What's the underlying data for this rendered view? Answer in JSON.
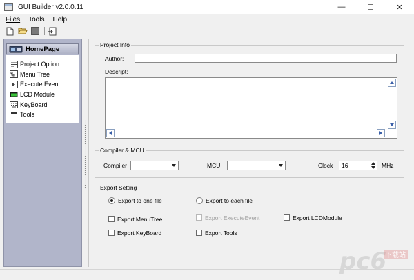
{
  "window": {
    "title": "GUI Builder v2.0.0.11",
    "controls": {
      "minimize": "—",
      "maximize": "☐",
      "close": "✕"
    }
  },
  "menu": {
    "items": [
      "Files",
      "Tools",
      "Help"
    ]
  },
  "toolbar": {
    "icons": [
      "new-file-icon",
      "open-folder-icon",
      "save-icon",
      "export-icon"
    ]
  },
  "sidebar": {
    "header": "HomePage",
    "items": [
      {
        "label": "Project Option",
        "icon": "project-option-icon"
      },
      {
        "label": "Menu Tree",
        "icon": "menu-tree-icon"
      },
      {
        "label": "Execute Event",
        "icon": "execute-event-icon"
      },
      {
        "label": "LCD Module",
        "icon": "lcd-module-icon"
      },
      {
        "label": "KeyBoard",
        "icon": "keyboard-icon"
      },
      {
        "label": "Tools",
        "icon": "tools-icon"
      }
    ]
  },
  "project_info": {
    "title": "Project Info",
    "author_label": "Author:",
    "author_value": "",
    "descript_label": "Descript:",
    "descript_value": ""
  },
  "compiler_mcu": {
    "title": "Compiler & MCU",
    "compiler_label": "Compiler",
    "compiler_value": "",
    "mcu_label": "MCU",
    "mcu_value": "",
    "clock_label": "Clock",
    "clock_value": "16",
    "clock_unit": "MHz"
  },
  "export_setting": {
    "title": "Export Setting",
    "radio_one_file": "Export to one file",
    "radio_each_file": "Export to each file",
    "selected_radio": "one_file",
    "chk_menutree": "Export MenuTree",
    "chk_executeevent": "Export ExecuteEvent",
    "chk_lcdmodule": "Export LCDModule",
    "chk_keyboard": "Export KeyBoard",
    "chk_tools": "Export Tools"
  },
  "watermark": {
    "text": "pc6",
    "sub": "下载站"
  },
  "colors": {
    "sidebar_bg": "#b1b5ca",
    "window_bg": "#f0f0f0",
    "accent": "#3a5fa8"
  }
}
